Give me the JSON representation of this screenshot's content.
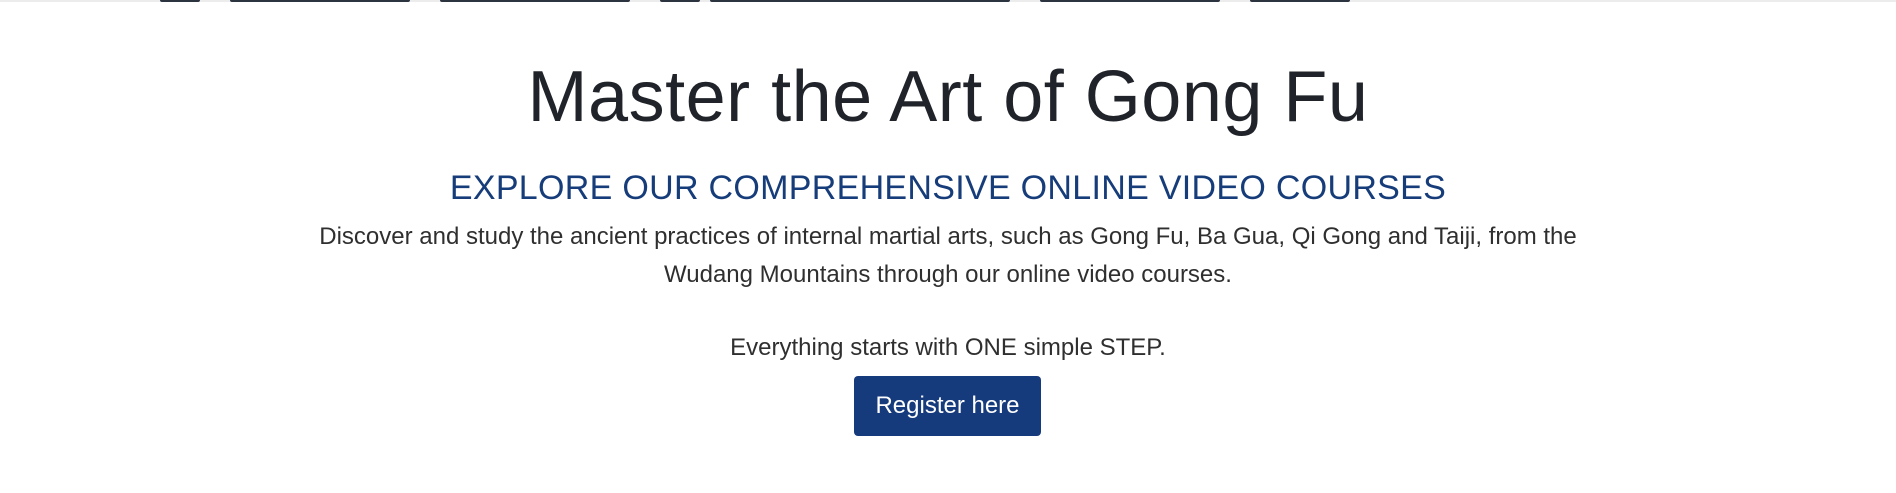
{
  "hero": {
    "title": "Master the Art of Gong Fu",
    "subtitle": "EXPLORE OUR COMPREHENSIVE ONLINE VIDEO COURSES",
    "description": "Discover and study the ancient practices of internal martial arts, such as Gong Fu, Ba Gua, Qi Gong and Taiji, from the Wudang Mountains through our online video courses.",
    "tagline": "Everything starts with ONE simple STEP.",
    "cta_label": "Register here"
  },
  "colors": {
    "accent": "#163b7d",
    "subtitle": "#163d7a",
    "title": "#20242a",
    "body_text": "#2f2f2f",
    "background": "#ffffff"
  }
}
